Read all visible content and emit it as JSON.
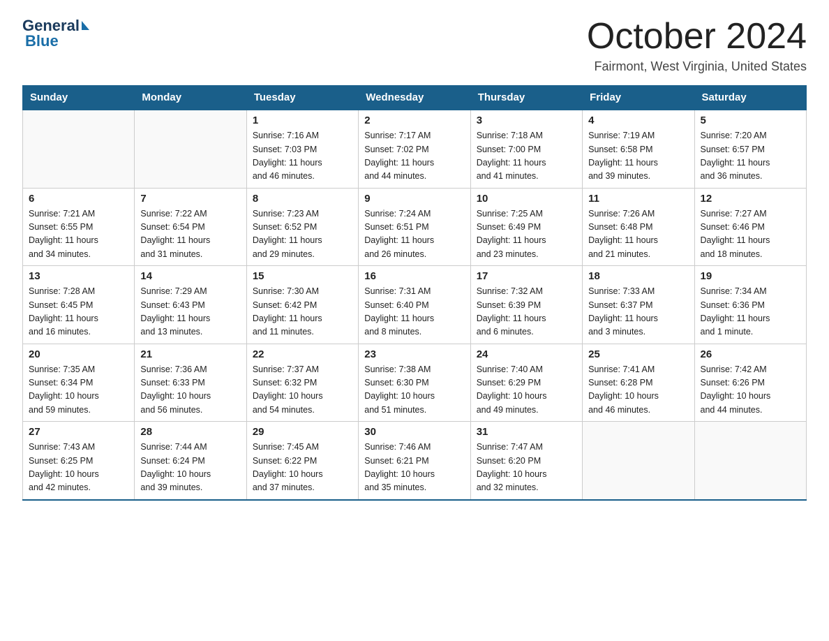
{
  "header": {
    "logo_general": "General",
    "logo_blue": "Blue",
    "month_title": "October 2024",
    "location": "Fairmont, West Virginia, United States"
  },
  "days_of_week": [
    "Sunday",
    "Monday",
    "Tuesday",
    "Wednesday",
    "Thursday",
    "Friday",
    "Saturday"
  ],
  "weeks": [
    [
      {
        "day": "",
        "info": ""
      },
      {
        "day": "",
        "info": ""
      },
      {
        "day": "1",
        "info": "Sunrise: 7:16 AM\nSunset: 7:03 PM\nDaylight: 11 hours\nand 46 minutes."
      },
      {
        "day": "2",
        "info": "Sunrise: 7:17 AM\nSunset: 7:02 PM\nDaylight: 11 hours\nand 44 minutes."
      },
      {
        "day": "3",
        "info": "Sunrise: 7:18 AM\nSunset: 7:00 PM\nDaylight: 11 hours\nand 41 minutes."
      },
      {
        "day": "4",
        "info": "Sunrise: 7:19 AM\nSunset: 6:58 PM\nDaylight: 11 hours\nand 39 minutes."
      },
      {
        "day": "5",
        "info": "Sunrise: 7:20 AM\nSunset: 6:57 PM\nDaylight: 11 hours\nand 36 minutes."
      }
    ],
    [
      {
        "day": "6",
        "info": "Sunrise: 7:21 AM\nSunset: 6:55 PM\nDaylight: 11 hours\nand 34 minutes."
      },
      {
        "day": "7",
        "info": "Sunrise: 7:22 AM\nSunset: 6:54 PM\nDaylight: 11 hours\nand 31 minutes."
      },
      {
        "day": "8",
        "info": "Sunrise: 7:23 AM\nSunset: 6:52 PM\nDaylight: 11 hours\nand 29 minutes."
      },
      {
        "day": "9",
        "info": "Sunrise: 7:24 AM\nSunset: 6:51 PM\nDaylight: 11 hours\nand 26 minutes."
      },
      {
        "day": "10",
        "info": "Sunrise: 7:25 AM\nSunset: 6:49 PM\nDaylight: 11 hours\nand 23 minutes."
      },
      {
        "day": "11",
        "info": "Sunrise: 7:26 AM\nSunset: 6:48 PM\nDaylight: 11 hours\nand 21 minutes."
      },
      {
        "day": "12",
        "info": "Sunrise: 7:27 AM\nSunset: 6:46 PM\nDaylight: 11 hours\nand 18 minutes."
      }
    ],
    [
      {
        "day": "13",
        "info": "Sunrise: 7:28 AM\nSunset: 6:45 PM\nDaylight: 11 hours\nand 16 minutes."
      },
      {
        "day": "14",
        "info": "Sunrise: 7:29 AM\nSunset: 6:43 PM\nDaylight: 11 hours\nand 13 minutes."
      },
      {
        "day": "15",
        "info": "Sunrise: 7:30 AM\nSunset: 6:42 PM\nDaylight: 11 hours\nand 11 minutes."
      },
      {
        "day": "16",
        "info": "Sunrise: 7:31 AM\nSunset: 6:40 PM\nDaylight: 11 hours\nand 8 minutes."
      },
      {
        "day": "17",
        "info": "Sunrise: 7:32 AM\nSunset: 6:39 PM\nDaylight: 11 hours\nand 6 minutes."
      },
      {
        "day": "18",
        "info": "Sunrise: 7:33 AM\nSunset: 6:37 PM\nDaylight: 11 hours\nand 3 minutes."
      },
      {
        "day": "19",
        "info": "Sunrise: 7:34 AM\nSunset: 6:36 PM\nDaylight: 11 hours\nand 1 minute."
      }
    ],
    [
      {
        "day": "20",
        "info": "Sunrise: 7:35 AM\nSunset: 6:34 PM\nDaylight: 10 hours\nand 59 minutes."
      },
      {
        "day": "21",
        "info": "Sunrise: 7:36 AM\nSunset: 6:33 PM\nDaylight: 10 hours\nand 56 minutes."
      },
      {
        "day": "22",
        "info": "Sunrise: 7:37 AM\nSunset: 6:32 PM\nDaylight: 10 hours\nand 54 minutes."
      },
      {
        "day": "23",
        "info": "Sunrise: 7:38 AM\nSunset: 6:30 PM\nDaylight: 10 hours\nand 51 minutes."
      },
      {
        "day": "24",
        "info": "Sunrise: 7:40 AM\nSunset: 6:29 PM\nDaylight: 10 hours\nand 49 minutes."
      },
      {
        "day": "25",
        "info": "Sunrise: 7:41 AM\nSunset: 6:28 PM\nDaylight: 10 hours\nand 46 minutes."
      },
      {
        "day": "26",
        "info": "Sunrise: 7:42 AM\nSunset: 6:26 PM\nDaylight: 10 hours\nand 44 minutes."
      }
    ],
    [
      {
        "day": "27",
        "info": "Sunrise: 7:43 AM\nSunset: 6:25 PM\nDaylight: 10 hours\nand 42 minutes."
      },
      {
        "day": "28",
        "info": "Sunrise: 7:44 AM\nSunset: 6:24 PM\nDaylight: 10 hours\nand 39 minutes."
      },
      {
        "day": "29",
        "info": "Sunrise: 7:45 AM\nSunset: 6:22 PM\nDaylight: 10 hours\nand 37 minutes."
      },
      {
        "day": "30",
        "info": "Sunrise: 7:46 AM\nSunset: 6:21 PM\nDaylight: 10 hours\nand 35 minutes."
      },
      {
        "day": "31",
        "info": "Sunrise: 7:47 AM\nSunset: 6:20 PM\nDaylight: 10 hours\nand 32 minutes."
      },
      {
        "day": "",
        "info": ""
      },
      {
        "day": "",
        "info": ""
      }
    ]
  ]
}
